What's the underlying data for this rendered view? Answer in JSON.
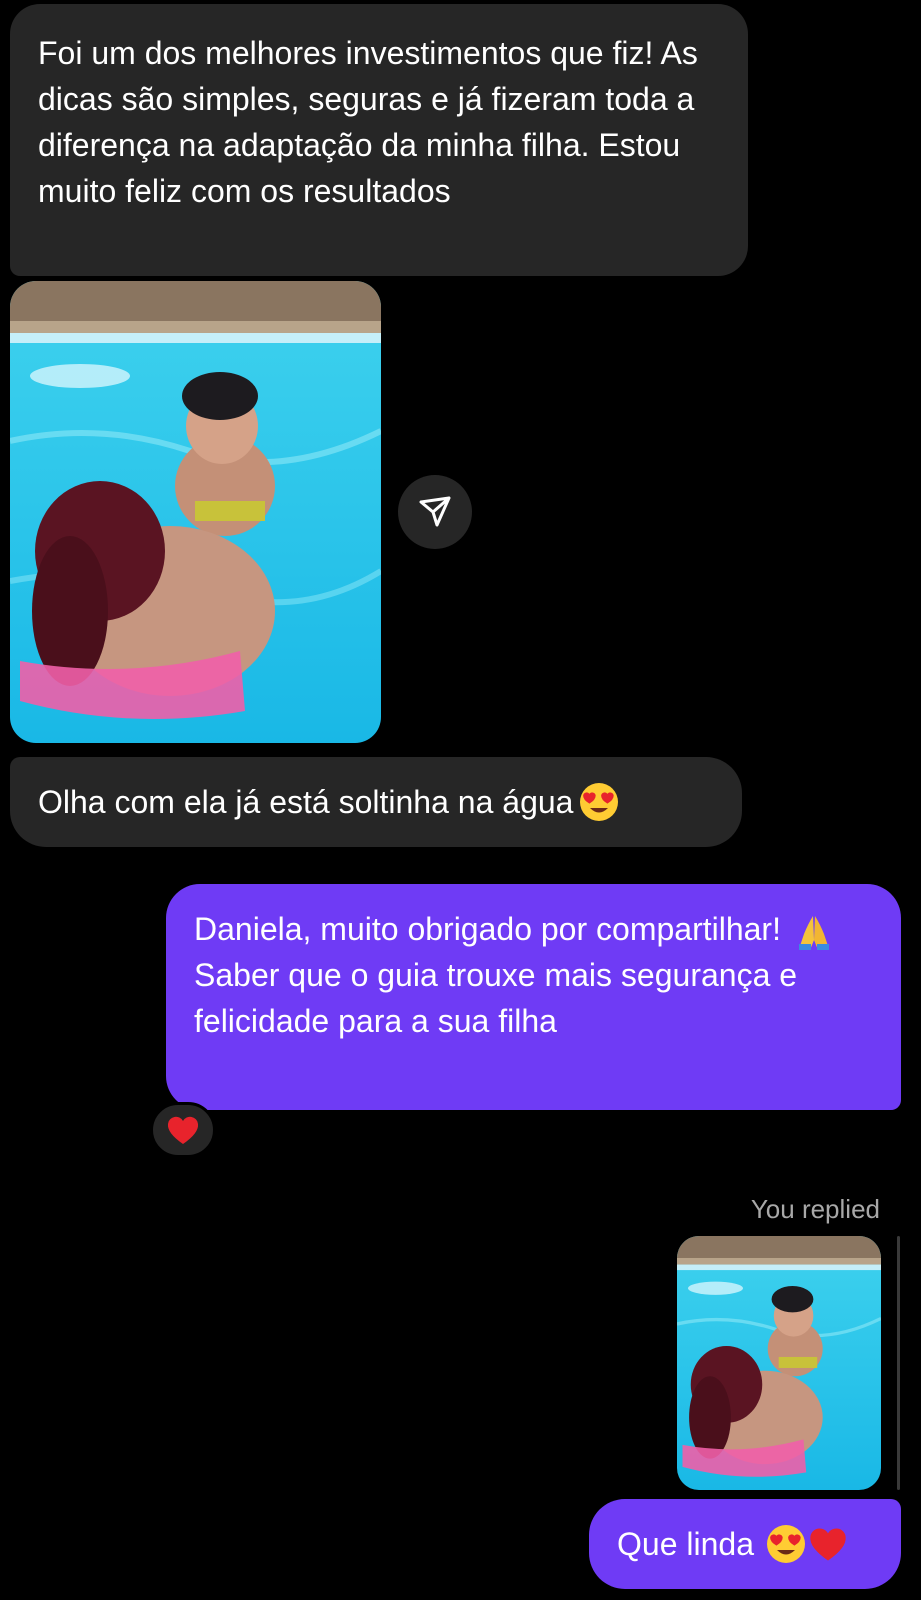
{
  "messages": {
    "received_1": {
      "text": "Foi um dos melhores investimentos que fiz! As dicas são simples, seguras e já fizeram toda a diferença na adaptação da minha filha. Estou muito feliz com os resultados"
    },
    "received_2": {
      "text": "Olha com ela já está soltinha na água",
      "emoji": "heart-eyes-emoji"
    },
    "sent_1": {
      "text_before_emoji": "Daniela, muito obrigado por compartilhar!",
      "emoji": "folded-hands-emoji",
      "text_after_emoji": "Saber que o guia trouxe mais segurança e felicidade para a sua filha",
      "reaction": "red-heart-emoji"
    },
    "reply_context": {
      "label": "You replied"
    },
    "sent_2": {
      "text": "Que linda",
      "emojis": [
        "heart-eyes-emoji",
        "red-heart-emoji"
      ]
    }
  },
  "icons": {
    "share": "paper-plane-icon"
  },
  "colors": {
    "background": "#000000",
    "received_bubble": "#262626",
    "sent_bubble": "#6f3bf5",
    "text": "#ffffff",
    "muted_text": "#a8a8a8",
    "heart": "#e8232c"
  }
}
